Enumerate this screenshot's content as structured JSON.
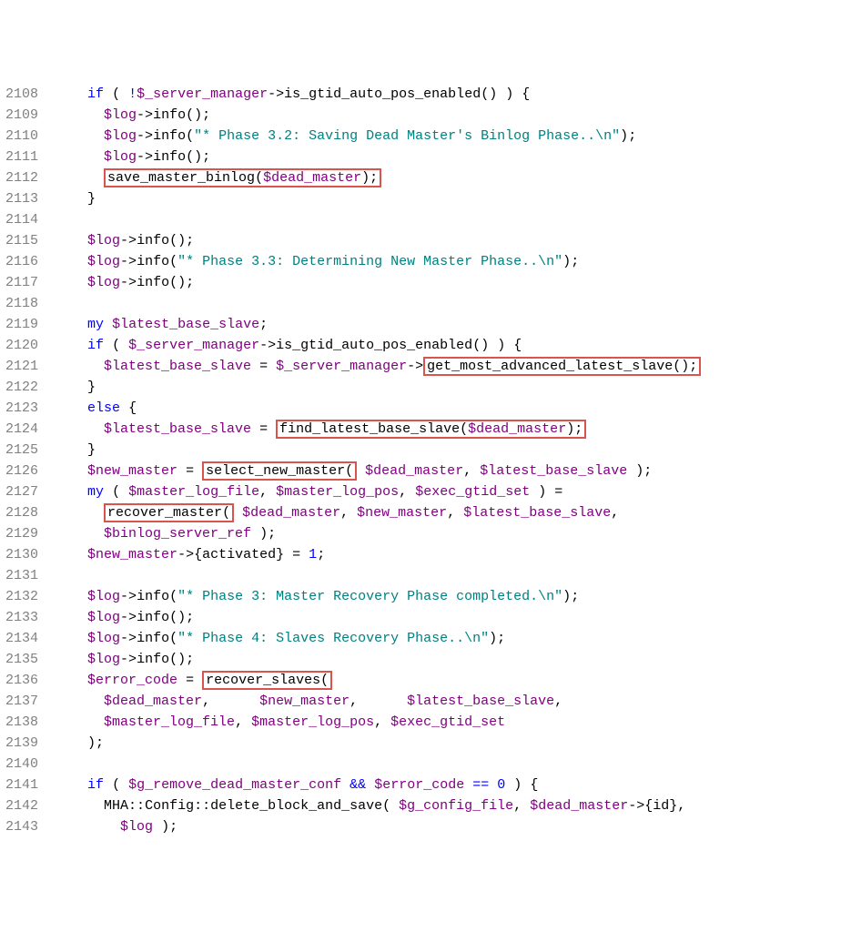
{
  "chart_data": {
    "type": "table",
    "title": "Perl source code snippet (lines 2108–2143)",
    "lines": [
      {
        "n": 2108,
        "code": "    if ( !$_server_manager->is_gtid_auto_pos_enabled() ) {"
      },
      {
        "n": 2109,
        "code": "      $log->info();"
      },
      {
        "n": 2110,
        "code": "      $log->info(\"* Phase 3.2: Saving Dead Master's Binlog Phase..\\n\");"
      },
      {
        "n": 2111,
        "code": "      $log->info();"
      },
      {
        "n": 2112,
        "code": "      save_master_binlog($dead_master);"
      },
      {
        "n": 2113,
        "code": "    }"
      },
      {
        "n": 2114,
        "code": ""
      },
      {
        "n": 2115,
        "code": "    $log->info();"
      },
      {
        "n": 2116,
        "code": "    $log->info(\"* Phase 3.3: Determining New Master Phase..\\n\");"
      },
      {
        "n": 2117,
        "code": "    $log->info();"
      },
      {
        "n": 2118,
        "code": ""
      },
      {
        "n": 2119,
        "code": "    my $latest_base_slave;"
      },
      {
        "n": 2120,
        "code": "    if ( $_server_manager->is_gtid_auto_pos_enabled() ) {"
      },
      {
        "n": 2121,
        "code": "      $latest_base_slave = $_server_manager->get_most_advanced_latest_slave();"
      },
      {
        "n": 2122,
        "code": "    }"
      },
      {
        "n": 2123,
        "code": "    else {"
      },
      {
        "n": 2124,
        "code": "      $latest_base_slave = find_latest_base_slave($dead_master);"
      },
      {
        "n": 2125,
        "code": "    }"
      },
      {
        "n": 2126,
        "code": "    $new_master = select_new_master( $dead_master, $latest_base_slave );"
      },
      {
        "n": 2127,
        "code": "    my ( $master_log_file, $master_log_pos, $exec_gtid_set ) ="
      },
      {
        "n": 2128,
        "code": "      recover_master( $dead_master, $new_master, $latest_base_slave,"
      },
      {
        "n": 2129,
        "code": "      $binlog_server_ref );"
      },
      {
        "n": 2130,
        "code": "    $new_master->{activated} = 1;"
      },
      {
        "n": 2131,
        "code": ""
      },
      {
        "n": 2132,
        "code": "    $log->info(\"* Phase 3: Master Recovery Phase completed.\\n\");"
      },
      {
        "n": 2133,
        "code": "    $log->info();"
      },
      {
        "n": 2134,
        "code": "    $log->info(\"* Phase 4: Slaves Recovery Phase..\\n\");"
      },
      {
        "n": 2135,
        "code": "    $log->info();"
      },
      {
        "n": 2136,
        "code": "    $error_code = recover_slaves("
      },
      {
        "n": 2137,
        "code": "      $dead_master,      $new_master,      $latest_base_slave,"
      },
      {
        "n": 2138,
        "code": "      $master_log_file, $master_log_pos, $exec_gtid_set"
      },
      {
        "n": 2139,
        "code": "    );"
      },
      {
        "n": 2140,
        "code": ""
      },
      {
        "n": 2141,
        "code": "    if ( $g_remove_dead_master_conf && $error_code == 0 ) {"
      },
      {
        "n": 2142,
        "code": "      MHA::Config::delete_block_and_save( $g_config_file, $dead_master->{id},"
      },
      {
        "n": 2143,
        "code": "        $log );"
      }
    ],
    "highlighted_regions": [
      {
        "line": 2112,
        "text": "save_master_binlog($dead_master);"
      },
      {
        "line": 2121,
        "text": "get_most_advanced_latest_slave();"
      },
      {
        "line": 2124,
        "text": "find_latest_base_slave($dead_master);"
      },
      {
        "line": 2126,
        "text": "select_new_master("
      },
      {
        "line": 2128,
        "text": "recover_master("
      },
      {
        "line": 2136,
        "text": "recover_slaves("
      }
    ]
  },
  "lineNumbers": [
    "2108",
    "2109",
    "2110",
    "2111",
    "2112",
    "2113",
    "2114",
    "2115",
    "2116",
    "2117",
    "2118",
    "2119",
    "2120",
    "2121",
    "2122",
    "2123",
    "2124",
    "2125",
    "2126",
    "2127",
    "2128",
    "2129",
    "2130",
    "2131",
    "2132",
    "2133",
    "2134",
    "2135",
    "2136",
    "2137",
    "2138",
    "2139",
    "2140",
    "2141",
    "2142",
    "2143"
  ],
  "t": {
    "if": "if",
    "else": "else",
    "my": "my",
    "not": "!",
    "arrow": "->",
    "eq": "=",
    "and": "&&",
    "eqeq": "==",
    "scope": "::",
    "lb": "{",
    "rb": "}",
    "lp": "(",
    "rp": ")",
    "semi": ";",
    "comma": ",",
    "v_server_manager": "$_server_manager",
    "v_log": "$log",
    "v_dead_master": "$dead_master",
    "v_latest_base_slave": "$latest_base_slave",
    "v_new_master": "$new_master",
    "v_master_log_file": "$master_log_file",
    "v_master_log_pos": "$master_log_pos",
    "v_exec_gtid_set": "$exec_gtid_set",
    "v_binlog_server_ref": "$binlog_server_ref",
    "v_error_code": "$error_code",
    "v_g_remove_dead_master_conf": "$g_remove_dead_master_conf",
    "v_g_config_file": "$g_config_file",
    "m_is_gtid": "is_gtid_auto_pos_enabled",
    "m_info": "info",
    "m_save_master_binlog": "save_master_binlog",
    "m_get_most_adv": "get_most_advanced_latest_slave",
    "m_find_latest": "find_latest_base_slave",
    "m_select_new_master": "select_new_master",
    "m_recover_master": "recover_master",
    "m_recover_slaves": "recover_slaves",
    "m_delete_block": "delete_block_and_save",
    "p_activated": "activated",
    "p_id": "id",
    "cls_mha": "MHA",
    "cls_config": "Config",
    "s32": "\"* Phase 3.2: Saving Dead Master's Binlog Phase..\\n\"",
    "s33": "\"* Phase 3.3: Determining New Master Phase..\\n\"",
    "s3c": "\"* Phase 3: Master Recovery Phase completed.\\n\"",
    "s4": "\"* Phase 4: Slaves Recovery Phase..\\n\"",
    "n0": "0",
    "n1": "1"
  }
}
